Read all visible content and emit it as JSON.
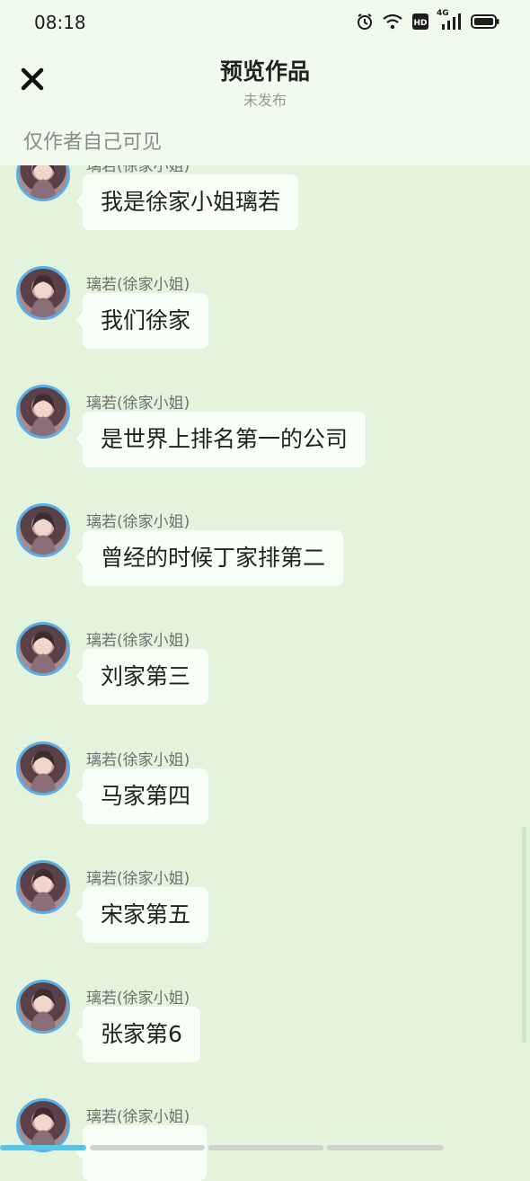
{
  "status_bar": {
    "time": "08:18",
    "network": "4G"
  },
  "header": {
    "title": "预览作品",
    "subtitle": "未发布",
    "visibility_note": "仅作者自己可见"
  },
  "colors": {
    "background": "#e3f3dc",
    "bubble": "#f8fff6",
    "avatar_ring": "#5aaee6"
  },
  "messages": [
    {
      "sender": "璃若(徐家小姐)",
      "text": "我是徐家小姐璃若"
    },
    {
      "sender": "璃若(徐家小姐)",
      "text": "我们徐家"
    },
    {
      "sender": "璃若(徐家小姐)",
      "text": "是世界上排名第一的公司"
    },
    {
      "sender": "璃若(徐家小姐)",
      "text": "曾经的时候丁家排第二"
    },
    {
      "sender": "璃若(徐家小姐)",
      "text": "刘家第三"
    },
    {
      "sender": "璃若(徐家小姐)",
      "text": "马家第四"
    },
    {
      "sender": "璃若(徐家小姐)",
      "text": "宋家第五"
    },
    {
      "sender": "璃若(徐家小姐)",
      "text": "张家第6"
    },
    {
      "sender": "璃若(徐家小姐)",
      "text": ""
    }
  ]
}
